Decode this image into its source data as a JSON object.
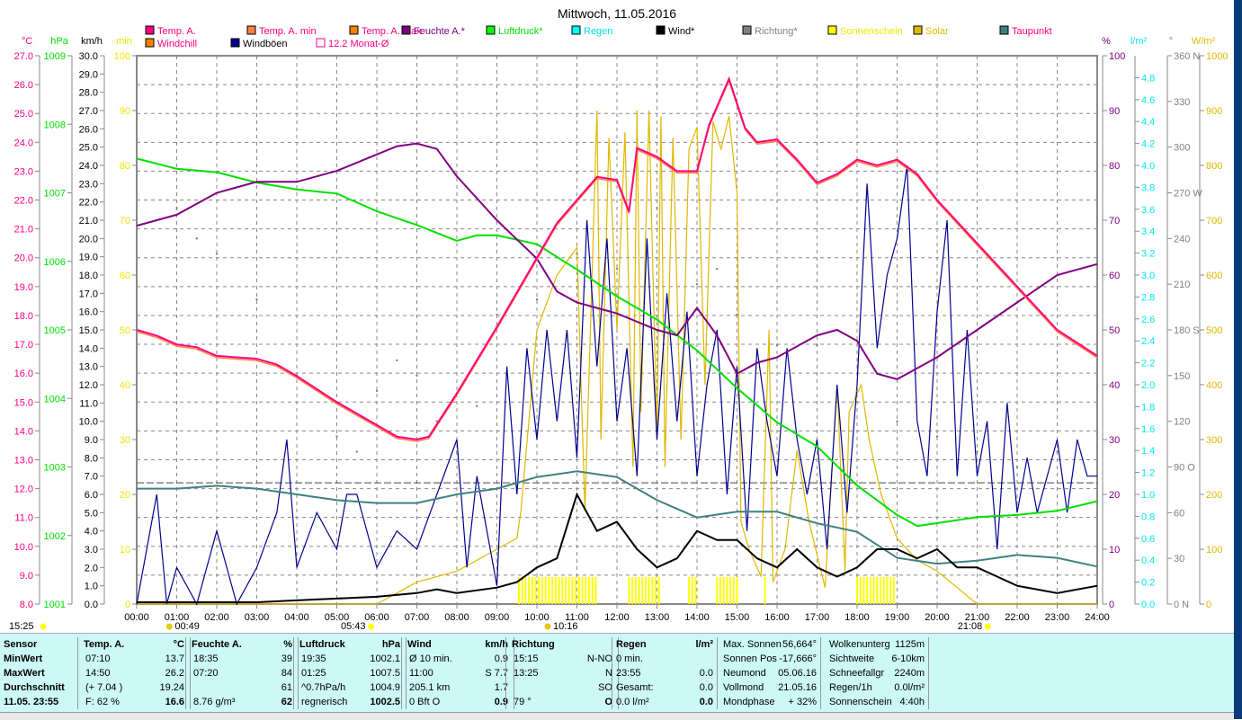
{
  "chart_data": {
    "type": "line",
    "title": "Mittwoch, 11.05.2016",
    "x_unit": "hours",
    "xlim": [
      0,
      24
    ],
    "x_ticks": [
      "00:00",
      "01:00",
      "02:00",
      "03:00",
      "04:00",
      "05:00",
      "06:00",
      "07:00",
      "08:00",
      "09:00",
      "10:00",
      "11:00",
      "12:00",
      "13:00",
      "14:00",
      "15:00",
      "16:00",
      "17:00",
      "18:00",
      "19:00",
      "20:00",
      "21:00",
      "22:00",
      "23:00",
      "24:00"
    ],
    "axes": {
      "temp": {
        "label": "°C",
        "range": [
          8.0,
          27.0
        ],
        "step": 1.0,
        "color": "#ff0080"
      },
      "pressure": {
        "label": "hPa",
        "range": [
          1001,
          1009
        ],
        "step": 1,
        "color": "#00e000"
      },
      "wind": {
        "label": "km/h",
        "range": [
          0,
          30
        ],
        "step": 1,
        "color": "#000000"
      },
      "minutes": {
        "label": "min",
        "range": [
          0,
          100
        ],
        "step": 10,
        "color": "#e8e800"
      },
      "humidity": {
        "label": "%",
        "range": [
          0,
          100
        ],
        "step": 10,
        "color": "#800080"
      },
      "rain": {
        "label": "l/m²",
        "range": [
          0,
          5.0
        ],
        "step": 0.2,
        "color": "#00e8e8"
      },
      "direction": {
        "label": "°",
        "range": [
          0,
          360
        ],
        "step": 30,
        "color": "#808080",
        "compass": {
          "360": "N",
          "270": "W",
          "180": "S",
          "90": "O",
          "0": "N"
        }
      },
      "solar": {
        "label": "W/m²",
        "range": [
          0,
          1000
        ],
        "step": 100,
        "color": "#e0b800"
      }
    },
    "legend": [
      {
        "name": "Temp. A.",
        "color": "#ff0080",
        "text_color": "#ff0080"
      },
      {
        "name": "Temp. A. min",
        "color": "#ff8040",
        "text_color": "#ff0080"
      },
      {
        "name": "Temp. A. max",
        "color": "#ff8000",
        "text_color": "#ff0080"
      },
      {
        "name": "Feuchte A.*",
        "color": "#800080",
        "text_color": "#800080"
      },
      {
        "name": "Luftdruck*",
        "color": "#00ff00",
        "text_color": "#00e000"
      },
      {
        "name": "Regen",
        "color": "#00ffff",
        "text_color": "#00e0e0"
      },
      {
        "name": "Wind*",
        "color": "#000000",
        "text_color": "#000000"
      },
      {
        "name": "Richtung*",
        "color": "#808080",
        "text_color": "#808080"
      },
      {
        "name": "Sonnenschein",
        "color": "#ffff00",
        "text_color": "#e8e800"
      },
      {
        "name": "Solar",
        "color": "#e0b800",
        "text_color": "#e0b800"
      },
      {
        "name": "Taupunkt",
        "color": "#408080",
        "text_color": "#ff0080"
      },
      {
        "name": "Windchill",
        "color": "#ff8000",
        "text_color": "#ff0080"
      },
      {
        "name": "Windböen",
        "color": "#000090",
        "text_color": "#000000"
      },
      {
        "name": "12.2 Monat-Ø",
        "color": "#ff0080",
        "text_color": "#ff0080"
      }
    ],
    "monthly_avg_temp": 12.2,
    "series": [
      {
        "name": "Temp. A.",
        "axis": "temp",
        "color": "#ff0080",
        "x": [
          0,
          0.5,
          1,
          1.5,
          2,
          3,
          3.5,
          4,
          5,
          6,
          6.5,
          7,
          7.3,
          8,
          9,
          9.5,
          10,
          10.5,
          11,
          11.5,
          12,
          12.3,
          12.5,
          13,
          13.5,
          14,
          14.3,
          14.8,
          15.2,
          15.5,
          16,
          16.5,
          17,
          17.5,
          18,
          18.5,
          19,
          19.5,
          20,
          21,
          22,
          23,
          24
        ],
        "y": [
          17.5,
          17.3,
          17.0,
          16.9,
          16.6,
          16.5,
          16.3,
          15.9,
          15.0,
          14.2,
          13.8,
          13.7,
          13.8,
          15.3,
          17.6,
          18.8,
          20.0,
          21.2,
          22.0,
          22.8,
          22.7,
          21.6,
          23.8,
          23.5,
          23.0,
          23.0,
          24.6,
          26.2,
          24.5,
          24.0,
          24.1,
          23.4,
          22.6,
          22.9,
          23.4,
          23.2,
          23.4,
          22.9,
          22.0,
          20.5,
          19.0,
          17.5,
          16.6
        ]
      },
      {
        "name": "Feuchte A.*",
        "axis": "humidity",
        "color": "#800080",
        "x": [
          0,
          1,
          2,
          3,
          4,
          5,
          6,
          6.5,
          7,
          7.5,
          8,
          9,
          10,
          10.5,
          11,
          11.5,
          12,
          13,
          13.5,
          14,
          14.5,
          15,
          15.5,
          16,
          17,
          17.5,
          18,
          18.5,
          19,
          20,
          21,
          22,
          23,
          24
        ],
        "y": [
          69,
          71,
          75,
          77,
          77,
          79,
          82,
          83.5,
          84,
          83,
          78,
          70,
          63,
          57,
          55,
          54,
          53,
          50,
          49,
          54,
          49,
          42,
          44,
          45,
          49,
          50,
          48,
          42,
          41,
          45,
          50,
          55,
          60,
          62
        ]
      },
      {
        "name": "Luftdruck*",
        "axis": "pressure",
        "color": "#00e000",
        "x": [
          0,
          1,
          2,
          3,
          4,
          5,
          6,
          7,
          8,
          8.5,
          9,
          10,
          11,
          12,
          13,
          14,
          15,
          16,
          17,
          18,
          19,
          19.5,
          20,
          21,
          22,
          23,
          24
        ],
        "y": [
          1007.5,
          1007.35,
          1007.3,
          1007.15,
          1007.05,
          1006.99,
          1006.73,
          1006.53,
          1006.3,
          1006.38,
          1006.38,
          1006.25,
          1005.88,
          1005.49,
          1005.15,
          1004.7,
          1004.15,
          1003.65,
          1003.3,
          1002.73,
          1002.3,
          1002.14,
          1002.18,
          1002.27,
          1002.3,
          1002.36,
          1002.5
        ]
      },
      {
        "name": "Taupunkt",
        "axis": "temp",
        "color": "#408080",
        "x": [
          0,
          1,
          2,
          3,
          4,
          5,
          6,
          7,
          8,
          9,
          10,
          11,
          12,
          13,
          14,
          15,
          16,
          17,
          18,
          19,
          20,
          21,
          22,
          23,
          24
        ],
        "y": [
          12.0,
          12.0,
          12.1,
          12.0,
          11.8,
          11.6,
          11.5,
          11.5,
          11.8,
          12.0,
          12.4,
          12.6,
          12.4,
          11.6,
          11.0,
          11.2,
          11.2,
          10.8,
          10.5,
          9.6,
          9.4,
          9.5,
          9.7,
          9.6,
          9.3
        ]
      },
      {
        "name": "Wind*",
        "axis": "wind",
        "color": "#000000",
        "x": [
          0,
          1,
          2,
          3,
          4,
          5,
          6,
          7,
          7.5,
          8,
          9,
          9.5,
          10,
          10.5,
          11,
          11.5,
          12,
          12.5,
          13,
          13.5,
          14,
          14.5,
          15,
          15.5,
          16,
          16.5,
          17,
          17.5,
          18,
          18.5,
          19,
          19.5,
          20,
          20.5,
          21,
          22,
          23,
          24
        ],
        "y": [
          0.1,
          0.1,
          0.1,
          0.1,
          0.2,
          0.3,
          0.4,
          0.6,
          0.8,
          0.6,
          0.9,
          1.2,
          2.0,
          2.5,
          6.0,
          4.0,
          4.5,
          3.0,
          2.0,
          2.5,
          4.0,
          3.5,
          3.5,
          2.5,
          2.0,
          3.0,
          2.0,
          1.5,
          2.0,
          3.0,
          3.0,
          2.5,
          3.0,
          2.0,
          2.0,
          1.0,
          0.6,
          1.0
        ]
      },
      {
        "name": "Windböen",
        "axis": "wind",
        "color": "#000090",
        "x": [
          0,
          0.5,
          0.75,
          1,
          1.5,
          2,
          2.5,
          3,
          3.5,
          3.75,
          4,
          4.5,
          5,
          5.25,
          5.5,
          6,
          6.5,
          7,
          7.5,
          8,
          8.25,
          8.5,
          9,
          9.25,
          9.5,
          9.75,
          10,
          10.25,
          10.5,
          10.75,
          11,
          11.25,
          11.5,
          11.75,
          12,
          12.25,
          12.5,
          12.75,
          13,
          13.25,
          13.5,
          13.75,
          14,
          14.25,
          14.5,
          14.75,
          15,
          15.25,
          15.5,
          15.75,
          16,
          16.25,
          16.5,
          16.75,
          17,
          17.25,
          17.5,
          17.75,
          18,
          18.25,
          18.5,
          18.75,
          19,
          19.25,
          19.5,
          19.75,
          20,
          20.25,
          20.5,
          20.75,
          21,
          21.25,
          21.5,
          21.75,
          22,
          22.25,
          22.5,
          22.75,
          23,
          23.25,
          23.5,
          23.75,
          24
        ],
        "y": [
          0,
          6.0,
          0,
          2.0,
          0,
          4.0,
          0,
          2.0,
          5.0,
          9.0,
          2.0,
          5.0,
          3.0,
          6.0,
          6.0,
          2.0,
          4.0,
          3.0,
          6.0,
          9.0,
          2.0,
          7.0,
          1.0,
          13.0,
          6.0,
          14.0,
          9.0,
          15.0,
          10.0,
          15.0,
          8.0,
          21.0,
          13.0,
          20.0,
          10.0,
          14.0,
          7.0,
          20.0,
          9.0,
          17.0,
          10.0,
          16.0,
          7.0,
          12.0,
          15.0,
          6.0,
          13.0,
          4.0,
          14.0,
          10.0,
          7.0,
          14.0,
          9.0,
          6.0,
          9.0,
          3.0,
          12.0,
          5.0,
          12.0,
          23.0,
          14.0,
          18.0,
          20.0,
          24.0,
          10.0,
          7.0,
          16.0,
          21.0,
          7.0,
          15.0,
          7.0,
          10.0,
          3.0,
          11.0,
          5.0,
          8.0,
          5.0,
          7.0,
          9.0,
          5.0,
          9.0,
          7.0,
          7.0
        ]
      },
      {
        "name": "Solar",
        "axis": "solar",
        "color": "#e0b800",
        "x": [
          0,
          6,
          6.5,
          7,
          8,
          9,
          9.5,
          9.6,
          10,
          10.5,
          11,
          11.2,
          11.5,
          11.6,
          11.8,
          12,
          12.2,
          12.4,
          12.5,
          12.6,
          12.8,
          13,
          13.1,
          13.2,
          13.4,
          13.6,
          13.8,
          14,
          14.2,
          14.4,
          14.6,
          14.8,
          15,
          15.1,
          15.3,
          15.6,
          15.8,
          15.9,
          16.2,
          16.5,
          16.8,
          17.2,
          17.5,
          17.7,
          17.8,
          18.1,
          18.3,
          18.6,
          19,
          19.5,
          20,
          20.5,
          21,
          21.1,
          24
        ],
        "y": [
          0,
          0,
          20,
          40,
          60,
          100,
          120,
          170,
          500,
          600,
          650,
          170,
          900,
          300,
          850,
          500,
          860,
          250,
          900,
          350,
          900,
          300,
          890,
          250,
          850,
          300,
          830,
          870,
          400,
          880,
          830,
          890,
          750,
          150,
          100,
          50,
          500,
          40,
          100,
          280,
          150,
          30,
          400,
          60,
          350,
          400,
          300,
          200,
          120,
          80,
          60,
          30,
          0,
          0,
          0
        ]
      },
      {
        "name": "Richtung*",
        "axis": "direction",
        "color": "#808080",
        "style": "dots",
        "x": [
          1,
          1.5,
          2,
          3,
          4,
          5,
          5.5,
          6,
          6.5,
          7,
          7.5,
          8,
          8.5,
          9,
          10,
          11,
          12,
          13,
          14,
          14.5,
          15,
          16,
          17,
          18,
          19,
          20,
          21,
          22,
          23,
          24
        ],
        "y": [
          260,
          240,
          230,
          200,
          150,
          110,
          100,
          140,
          160,
          150,
          120,
          100,
          130,
          190,
          200,
          230,
          220,
          260,
          210,
          220,
          190,
          170,
          170,
          140,
          120,
          110,
          100,
          90,
          100,
          90
        ]
      }
    ],
    "sunshine_intervals": [
      [
        9.55,
        11.5
      ],
      [
        12.3,
        13.1
      ],
      [
        13.8,
        14.05
      ],
      [
        14.5,
        15.05
      ],
      [
        15.7,
        15.75
      ],
      [
        18.0,
        19.0
      ]
    ],
    "markers": [
      {
        "label": "15:25",
        "type": "moonset"
      },
      {
        "label": "00:49",
        "type": "moonrise"
      },
      {
        "label": "05:43",
        "type": "sunrise"
      },
      {
        "label": "10:16",
        "type": "moon"
      },
      {
        "label": "21:08",
        "type": "sunset"
      }
    ]
  },
  "table": {
    "sensor": {
      "header": "Sensor",
      "rows": [
        "MinWert",
        "MaxWert",
        "Durchschnitt",
        "11.05. 23:55"
      ]
    },
    "temp": {
      "header": "Temp. A.",
      "unit": "°C",
      "rows": [
        [
          "07:10",
          "13.7"
        ],
        [
          "14:50",
          "26.2"
        ],
        [
          "(+ 7.04 )",
          "19.24"
        ],
        [
          "F: 62 %",
          "16.6"
        ]
      ]
    },
    "humidity": {
      "header": "Feuchte A.",
      "unit": "%",
      "rows": [
        [
          "18:35",
          "39"
        ],
        [
          "07:20",
          "84"
        ],
        [
          "",
          "61"
        ],
        [
          "8.76 g/m³",
          "62"
        ]
      ]
    },
    "pressure": {
      "header": "Luftdruck",
      "unit": "hPa",
      "rows": [
        [
          "19:35",
          "1002.1"
        ],
        [
          "01:25",
          "1007.5"
        ],
        [
          "^0.7hPa/h",
          "1004.9"
        ],
        [
          "regnerisch",
          "1002.5"
        ]
      ]
    },
    "wind": {
      "header": "Wind",
      "unit": "km/h",
      "rows": [
        [
          "Ø 10 min.",
          "0.9"
        ],
        [
          "11:00",
          "S 7.7"
        ],
        [
          "205.1 km",
          "1.7"
        ],
        [
          "0 Bft O",
          "0.9"
        ]
      ]
    },
    "direction": {
      "header": "Richtung",
      "unit": "",
      "rows": [
        [
          "15:15",
          "N-NO"
        ],
        [
          "13:25",
          "N"
        ],
        [
          "",
          "SO"
        ],
        [
          "79 °",
          "O"
        ]
      ]
    },
    "rain": {
      "header": "Regen",
      "unit": "l/m²",
      "rows": [
        [
          "0 min.",
          ""
        ],
        [
          "23:55",
          "0.0"
        ],
        [
          "Gesamt:",
          "0.0"
        ],
        [
          "0.0 l/m²",
          "0.0"
        ]
      ]
    },
    "sun": {
      "rows": [
        [
          "Max. Sonnen",
          "56,664°"
        ],
        [
          "Sonnen Pos",
          "-17,666°"
        ],
        [
          "Neumond",
          "05.06.16"
        ],
        [
          "Vollmond",
          "21.05.16"
        ],
        [
          "Mondphase",
          "+ 32%"
        ]
      ]
    },
    "misc": {
      "rows": [
        [
          "Wolkenunterg",
          "1125m"
        ],
        [
          "Sichtweite",
          "6-10km"
        ],
        [
          "Schneefallgr",
          "2240m"
        ],
        [
          "Regen/1h",
          "0.0l/m²"
        ],
        [
          "Sonnenschein",
          "4:40h"
        ]
      ]
    }
  }
}
